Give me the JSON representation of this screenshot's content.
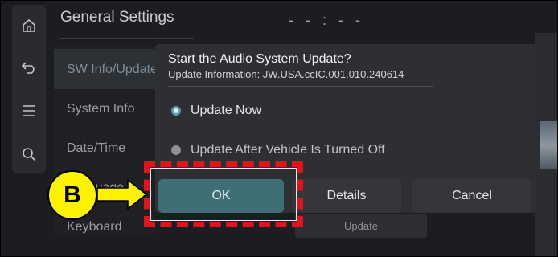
{
  "header": {
    "title": "General Settings",
    "clock": "- - : - -"
  },
  "rail": {
    "icons": [
      "home-icon",
      "back-icon",
      "menu-icon",
      "search-icon"
    ]
  },
  "menu": {
    "items": [
      {
        "label": "SW Info/Update",
        "selected": true
      },
      {
        "label": "System Info"
      },
      {
        "label": "Date/Time"
      },
      {
        "label": "Language"
      },
      {
        "label": "Keyboard"
      }
    ]
  },
  "dialog": {
    "title": "Start the Audio System Update?",
    "subtitle": "Update Information: JW.USA.ccIC.001.010.240614",
    "options": [
      {
        "label": "Update Now",
        "selected": true
      },
      {
        "label": "Update After Vehicle Is Turned Off",
        "selected": false
      }
    ],
    "buttons": {
      "ok": "OK",
      "details": "Details",
      "cancel": "Cancel"
    }
  },
  "background_button": {
    "label": "Update"
  },
  "annotation": {
    "callout_letter": "B"
  },
  "colors": {
    "highlight": "#e3121b",
    "callout": "#fff200",
    "ok_button": "#3d6f74",
    "radio_on": "#5f9aa4"
  }
}
